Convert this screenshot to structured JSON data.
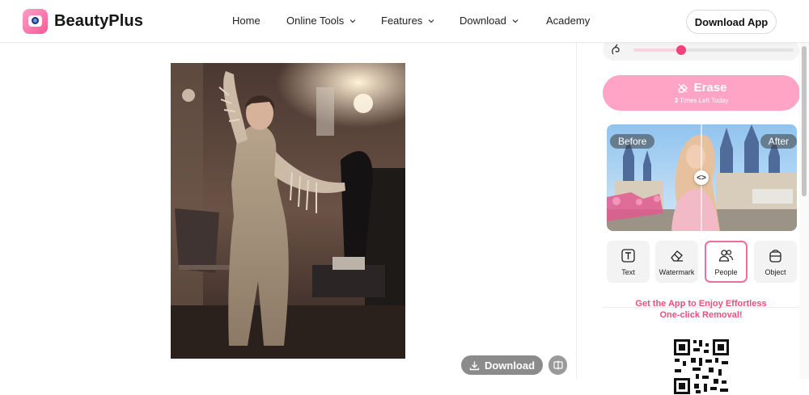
{
  "brand": {
    "name": "BeautyPlus"
  },
  "nav": {
    "items": [
      {
        "label": "Home",
        "has_dropdown": false
      },
      {
        "label": "Online Tools",
        "has_dropdown": true
      },
      {
        "label": "Features",
        "has_dropdown": true
      },
      {
        "label": "Download",
        "has_dropdown": true
      },
      {
        "label": "Academy",
        "has_dropdown": false
      }
    ],
    "cta_label": "Download App"
  },
  "canvas": {
    "download_label": "Download",
    "compare_icon": "compare-icon"
  },
  "panel": {
    "brush_size_fraction": 0.3,
    "erase": {
      "label": "Erase",
      "remaining_count": "3",
      "remaining_suffix": "Times Left Today"
    },
    "preview": {
      "before_label": "Before",
      "after_label": "After",
      "handle_glyph": "<>"
    },
    "modes": [
      {
        "label": "Text",
        "icon": "text-icon",
        "active": false
      },
      {
        "label": "Watermark",
        "icon": "eraser-icon",
        "active": false
      },
      {
        "label": "People",
        "icon": "people-icon",
        "active": true
      },
      {
        "label": "Object",
        "icon": "object-icon",
        "active": false
      }
    ],
    "promo_line1": "Get the App to Enjoy Effortless",
    "promo_line2": "One-click Removal!"
  },
  "colors": {
    "accent": "#f0427c",
    "erase_button": "#ffa4c4",
    "promo_text": "#ef4e7b",
    "download_button": "#8b8b8b"
  }
}
